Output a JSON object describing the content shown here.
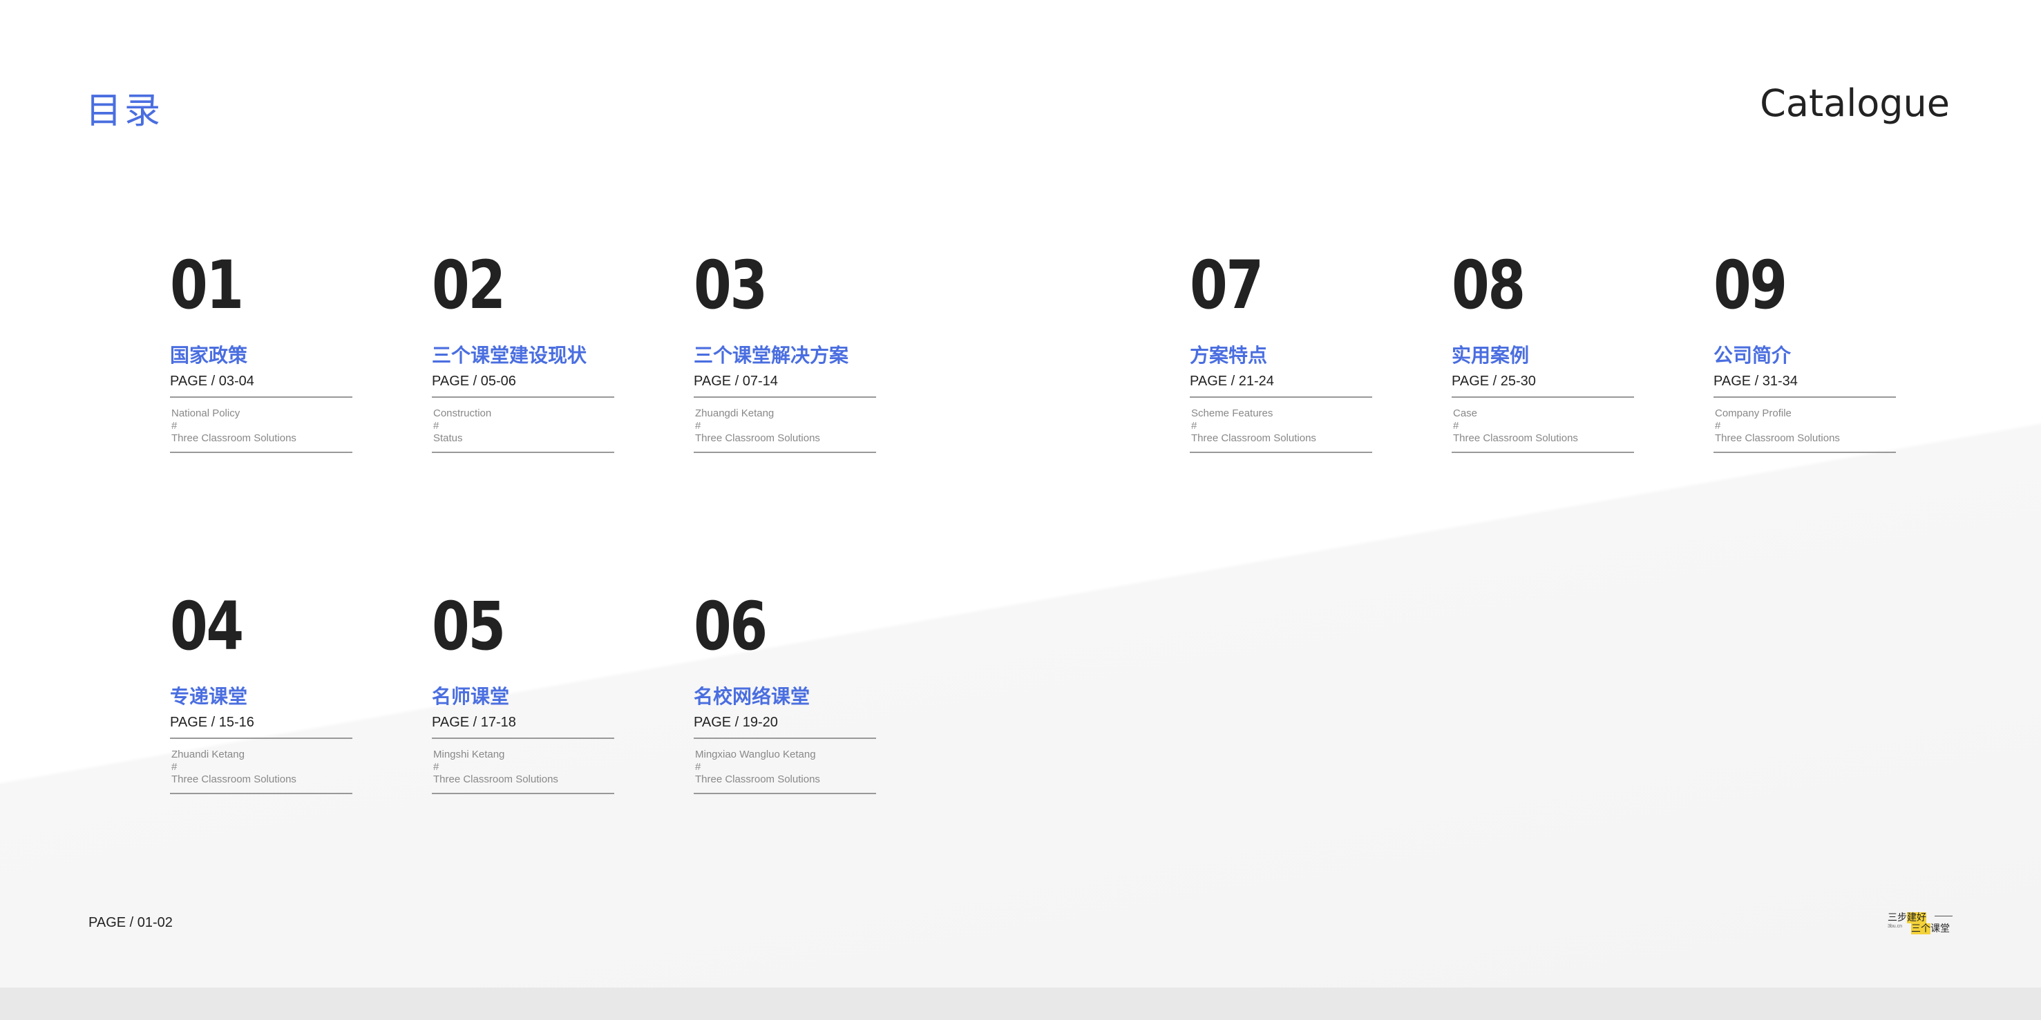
{
  "header": {
    "title_cn": "目录",
    "title_en": "Catalogue"
  },
  "items": [
    {
      "num": "01",
      "cn": "国家政策",
      "page": "PAGE / 03-04",
      "desc1": "National Policy",
      "desc2": "#",
      "desc3": "Three Classroom Solutions"
    },
    {
      "num": "02",
      "cn": "三个课堂建设现状",
      "page": "PAGE / 05-06",
      "desc1": "Construction",
      "desc2": "#",
      "desc3": "Status"
    },
    {
      "num": "03",
      "cn": "三个课堂解决方案",
      "page": "PAGE / 07-14",
      "desc1": "Zhuangdi Ketang",
      "desc2": "#",
      "desc3": "Three Classroom Solutions"
    },
    {
      "num": "07",
      "cn": "方案特点",
      "page": "PAGE / 21-24",
      "desc1": "Scheme Features",
      "desc2": "#",
      "desc3": "Three Classroom Solutions"
    },
    {
      "num": "08",
      "cn": "实用案例",
      "page": "PAGE / 25-30",
      "desc1": "Case",
      "desc2": "#",
      "desc3": "Three Classroom Solutions"
    },
    {
      "num": "09",
      "cn": "公司简介",
      "page": "PAGE / 31-34",
      "desc1": "Company Profile",
      "desc2": "#",
      "desc3": "Three Classroom Solutions"
    },
    {
      "num": "04",
      "cn": "专递课堂",
      "page": "PAGE / 15-16",
      "desc1": "Zhuandi Ketang",
      "desc2": "#",
      "desc3": "Three Classroom Solutions"
    },
    {
      "num": "05",
      "cn": "名师课堂",
      "page": "PAGE / 17-18",
      "desc1": "Mingshi Ketang",
      "desc2": "#",
      "desc3": "Three Classroom Solutions"
    },
    {
      "num": "06",
      "cn": "名校网络课堂",
      "page": "PAGE / 19-20",
      "desc1": "Mingxiao Wangluo Ketang",
      "desc2": "#",
      "desc3": "Three Classroom Solutions"
    }
  ],
  "footer": {
    "page": "PAGE / 01-02"
  },
  "logo": {
    "line1_a": "三步",
    "line1_b": "建好",
    "line2": "3bu.cn",
    "line3_a": "三个",
    "line3_b": "课堂"
  },
  "colors": {
    "accent": "#4a6ee0",
    "text": "#222222",
    "muted": "#888888",
    "logo_highlight": "#f3d23a"
  }
}
